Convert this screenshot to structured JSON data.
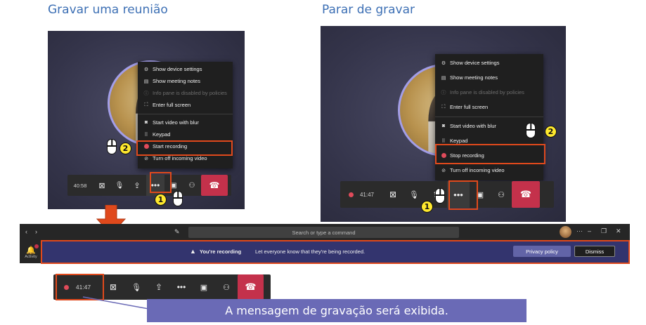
{
  "headings": {
    "record": "Gravar uma reunião",
    "stop": "Parar de gravar"
  },
  "left_menu": {
    "items": [
      {
        "icon": "gear-icon",
        "label": "Show device settings"
      },
      {
        "icon": "notes-icon",
        "label": "Show meeting notes"
      },
      {
        "icon": "info-icon",
        "label": "Info pane is disabled by policies",
        "disabled": true
      },
      {
        "icon": "fullscreen-icon",
        "label": "Enter full screen"
      },
      {
        "icon": "blur-icon",
        "label": "Start video with blur"
      },
      {
        "icon": "keypad-icon",
        "label": "Keypad"
      },
      {
        "icon": "record-icon",
        "label": "Start recording"
      },
      {
        "icon": "video-off-icon",
        "label": "Turn off incoming video"
      }
    ]
  },
  "right_menu": {
    "items": [
      {
        "icon": "gear-icon",
        "label": "Show device settings"
      },
      {
        "icon": "notes-icon",
        "label": "Show meeting notes"
      },
      {
        "icon": "info-icon",
        "label": "Info pane is disabled by policies",
        "disabled": true
      },
      {
        "icon": "fullscreen-icon",
        "label": "Enter full screen"
      },
      {
        "icon": "blur-icon",
        "label": "Start video with blur"
      },
      {
        "icon": "keypad-icon",
        "label": "Keypad"
      },
      {
        "icon": "record-icon",
        "label": "Stop recording"
      },
      {
        "icon": "video-off-icon",
        "label": "Turn off incoming video"
      }
    ]
  },
  "left_bar": {
    "time": "40:58"
  },
  "right_bar": {
    "time": "41:47"
  },
  "bottom_bar": {
    "time": "41:47"
  },
  "steps": {
    "one": "1",
    "two": "2"
  },
  "titlebar": {
    "search_placeholder": "Search or type a command"
  },
  "sidebar": {
    "activity_label": "Activity"
  },
  "banner": {
    "title": "You're recording",
    "message": "Let everyone know that they're being recorded.",
    "privacy_label": "Privacy policy",
    "dismiss_label": "Dismiss"
  },
  "caption": "A mensagem de gravação será exibida.",
  "colors": {
    "heading": "#3c6fb4",
    "highlight": "#e0491c",
    "hangup": "#c4314b",
    "banner": "#33346e",
    "caption": "#6a6ab6",
    "record": "#e04b5a"
  }
}
